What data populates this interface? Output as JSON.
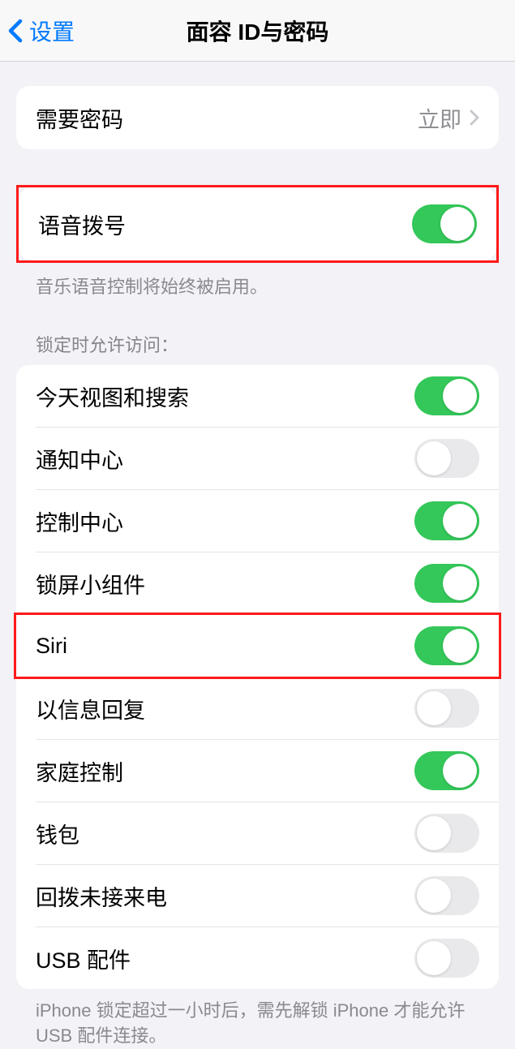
{
  "header": {
    "back_label": "设置",
    "title": "面容 ID与密码"
  },
  "require_passcode": {
    "label": "需要密码",
    "value": "立即"
  },
  "voice_dial": {
    "label": "语音拨号",
    "footer": "音乐语音控制将始终被启用。"
  },
  "lock_access": {
    "header": "锁定时允许访问：",
    "items": [
      {
        "label": "今天视图和搜索",
        "on": true
      },
      {
        "label": "通知中心",
        "on": false
      },
      {
        "label": "控制中心",
        "on": true
      },
      {
        "label": "锁屏小组件",
        "on": true
      },
      {
        "label": "Siri",
        "on": true,
        "highlight": true
      },
      {
        "label": "以信息回复",
        "on": false
      },
      {
        "label": "家庭控制",
        "on": true
      },
      {
        "label": "钱包",
        "on": false
      },
      {
        "label": "回拨未接来电",
        "on": false
      },
      {
        "label": "USB 配件",
        "on": false
      }
    ],
    "footer": "iPhone 锁定超过一小时后，需先解锁 iPhone 才能允许USB 配件连接。"
  }
}
